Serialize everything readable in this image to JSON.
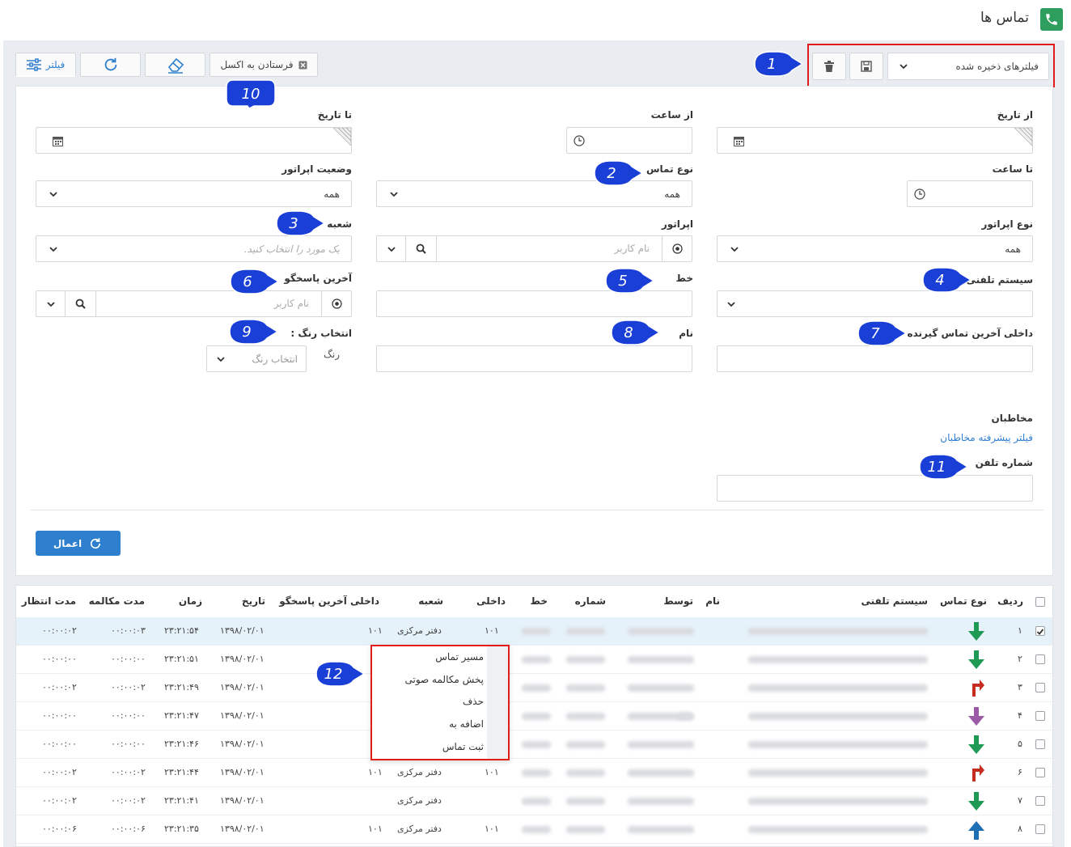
{
  "header": {
    "title": "تماس ها"
  },
  "toolbar": {
    "filter_label": "فیلتر",
    "excel_label": "فرستادن به اکسل",
    "saved_filters_placeholder": "فیلترهای ذخیره شده"
  },
  "form": {
    "from_date_label": "از تاریخ",
    "from_time_label": "از ساعت",
    "to_date_label": "تا تاریخ",
    "to_time_label": "تا ساعت",
    "call_type_label": "نوع تماس",
    "call_type_value": "همه",
    "operator_status_label": "وضعیت اپراتور",
    "operator_status_value": "همه",
    "operator_type_label": "نوع اپراتور",
    "operator_type_value": "همه",
    "operator_label": "اپراتور",
    "operator_placeholder": "نام کاربر",
    "branch_label": "شعبه",
    "branch_placeholder": "یک مورد را انتخاب کنید.",
    "phone_system_label": "سیستم تلفنی",
    "line_label": "خط",
    "last_responder_label": "آخرین پاسخگو",
    "last_responder_placeholder": "نام کاربر",
    "last_receiver_ext_label": "داخلی آخرین تماس گیرنده",
    "name_label": "نام",
    "color_label": "انتخاب رنگ :",
    "color_sub": "رنگ",
    "color_placeholder": "انتخاب رنگ",
    "contacts_label": "مخاطبان",
    "contacts_link": "فیلتر پیشرفته مخاطبان",
    "phone_label": "شماره تلفن",
    "apply_label": "اعمال"
  },
  "callouts": [
    "1",
    "2",
    "3",
    "4",
    "5",
    "6",
    "7",
    "8",
    "9",
    "10",
    "11",
    "12"
  ],
  "table": {
    "headers": {
      "row": "ردیف",
      "type": "نوع تماس",
      "system": "سیستم تلفنی",
      "name": "نام",
      "by": "توسط",
      "number": "شماره",
      "line": "خط",
      "ext": "داخلی",
      "branch": "شعبه",
      "last_ext": "داخلی آخرین پاسخگو",
      "date": "تاریخ",
      "time": "زمان",
      "talk": "مدت مکالمه",
      "wait": "مدت انتظار"
    },
    "rows": [
      {
        "num": "۱",
        "type": "in",
        "ext": "۱۰۱",
        "branch": "دفتر مرکزی",
        "last_ext": "۱۰۱",
        "date": "۱۳۹۸/۰۲/۰۱",
        "time": "۲۳:۲۱:۵۴",
        "talk": "۰۰:۰۰:۰۳",
        "wait": "۰۰:۰۰:۰۲",
        "checked": true
      },
      {
        "num": "۲",
        "type": "in",
        "ext": "",
        "branch": "",
        "last_ext": "",
        "date": "۱۳۹۸/۰۲/۰۱",
        "time": "۲۳:۲۱:۵۱",
        "talk": "۰۰:۰۰:۰۰",
        "wait": "۰۰:۰۰:۰۰",
        "checked": false
      },
      {
        "num": "۳",
        "type": "return",
        "ext": "",
        "branch": "",
        "last_ext": "",
        "date": "۱۳۹۸/۰۲/۰۱",
        "time": "۲۳:۲۱:۴۹",
        "talk": "۰۰:۰۰:۰۲",
        "wait": "۰۰:۰۰:۰۲",
        "checked": false
      },
      {
        "num": "۴",
        "type": "internal",
        "ext": "",
        "branch": "",
        "last_ext": "",
        "date": "۱۳۹۸/۰۲/۰۱",
        "time": "۲۳:۲۱:۴۷",
        "talk": "۰۰:۰۰:۰۰",
        "wait": "۰۰:۰۰:۰۰",
        "checked": false
      },
      {
        "num": "۵",
        "type": "in",
        "ext": "",
        "branch": "",
        "last_ext": "",
        "date": "۱۳۹۸/۰۲/۰۱",
        "time": "۲۳:۲۱:۴۶",
        "talk": "۰۰:۰۰:۰۰",
        "wait": "۰۰:۰۰:۰۰",
        "checked": false
      },
      {
        "num": "۶",
        "type": "return",
        "ext": "۱۰۱",
        "branch": "دفتر مرکزی",
        "last_ext": "۱۰۱",
        "date": "۱۳۹۸/۰۲/۰۱",
        "time": "۲۳:۲۱:۴۴",
        "talk": "۰۰:۰۰:۰۲",
        "wait": "۰۰:۰۰:۰۲",
        "checked": false
      },
      {
        "num": "۷",
        "type": "in",
        "ext": "",
        "branch": "دفتر مرکزی",
        "last_ext": "",
        "date": "۱۳۹۸/۰۲/۰۱",
        "time": "۲۳:۲۱:۴۱",
        "talk": "۰۰:۰۰:۰۲",
        "wait": "۰۰:۰۰:۰۲",
        "checked": false
      },
      {
        "num": "۸",
        "type": "out",
        "ext": "۱۰۱",
        "branch": "دفتر مرکزی",
        "last_ext": "۱۰۱",
        "date": "۱۳۹۸/۰۲/۰۱",
        "time": "۲۳:۲۱:۳۵",
        "talk": "۰۰:۰۰:۰۶",
        "wait": "۰۰:۰۰:۰۶",
        "checked": false
      }
    ]
  },
  "context_menu": [
    "مسیر تماس",
    "پخش مکالمه صوتی",
    "حذف",
    "اضافه به",
    "ثبت تماس"
  ],
  "colors": {
    "accent": "#2f7fcf",
    "callout": "#1a3fd6",
    "highlight": "#e21b1b",
    "in": "#1f9a55",
    "out": "#1f6fb5",
    "return": "#c62b1f",
    "internal": "#9b5aa6"
  }
}
